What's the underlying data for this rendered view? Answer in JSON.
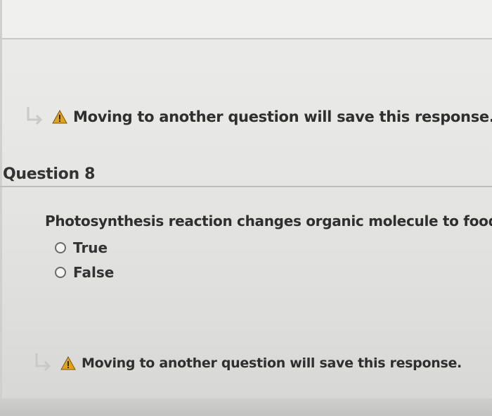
{
  "warnings": [
    {
      "text": "Moving to another question will save this response."
    },
    {
      "text": "Moving to another question will save this response."
    }
  ],
  "question": {
    "title": "Question 8",
    "prompt": "Photosynthesis reaction changes organic molecule to food",
    "options": [
      {
        "label": "True",
        "selected": false
      },
      {
        "label": "False",
        "selected": false
      }
    ]
  },
  "colors": {
    "warning_icon": "#e0a21a",
    "text": "#2f2f2f"
  },
  "icons": {
    "arrow": "return-arrow-icon",
    "warning": "warning-icon"
  }
}
